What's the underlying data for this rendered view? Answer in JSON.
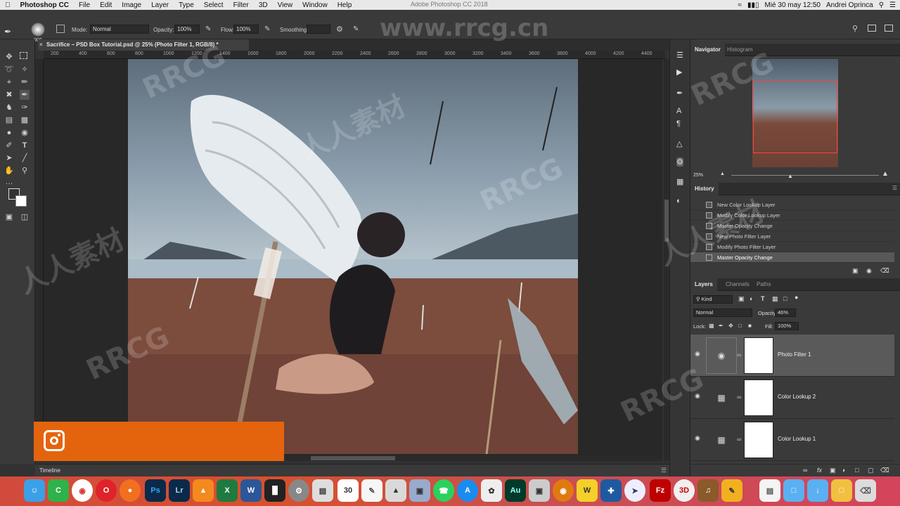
{
  "menubar": {
    "apple": "",
    "items": [
      "Photoshop CC",
      "File",
      "Edit",
      "Image",
      "Layer",
      "Type",
      "Select",
      "Filter",
      "3D",
      "View",
      "Window",
      "Help"
    ],
    "window_title": "Adobe Photoshop CC 2018",
    "clock": "Mié 30 may  12:50",
    "user": "Andrei Oprinca"
  },
  "options": {
    "brush_size": "900",
    "mode_label": "Mode:",
    "mode_value": "Normal",
    "opacity_label": "Opacity:",
    "opacity_value": "100%",
    "flow_label": "Flow:",
    "flow_value": "100%",
    "smoothing_label": "Smoothing:"
  },
  "document": {
    "tab_title": "Sacrifice – PSD Box Tutorial.psd @ 25% (Photo Filter 1, RGB/8) *"
  },
  "ruler_ticks": [
    "200",
    "400",
    "600",
    "800",
    "1000",
    "1200",
    "1400",
    "1600",
    "1800",
    "2000",
    "2200",
    "2400",
    "2600",
    "2800",
    "3000",
    "3200",
    "3400",
    "3600",
    "3800",
    "4000",
    "4200",
    "4400"
  ],
  "timeline": {
    "label": "Timeline"
  },
  "navigator": {
    "tab_active": "Navigator",
    "tab_other": "Histogram",
    "zoom": "25%"
  },
  "history": {
    "title": "History",
    "items": [
      "New Color Lookup Layer",
      "Modify Color Lookup Layer",
      "Master Opacity Change",
      "New Photo Filter Layer",
      "Modify Photo Filter Layer",
      "Master Opacity Change"
    ]
  },
  "layers": {
    "tabs": [
      "Layers",
      "Channels",
      "Paths"
    ],
    "kind_label": "Kind",
    "blend_mode": "Normal",
    "opacity_label": "Opacity:",
    "opacity_value": "46%",
    "lock_label": "Lock:",
    "fill_label": "Fill:",
    "fill_value": "100%",
    "items": [
      {
        "name": "Photo Filter 1",
        "icon": "photo-filter-icon",
        "selected": true
      },
      {
        "name": "Color Lookup 2",
        "icon": "grid-icon",
        "selected": false
      },
      {
        "name": "Color Lookup 1",
        "icon": "grid-icon",
        "selected": false
      }
    ]
  },
  "watermark": {
    "site": "www.rrcg.cn",
    "brand": "RRCG",
    "cn": "人人素材"
  },
  "colors": {
    "banner": "#e4640e",
    "panel_bg": "#3a3a3a",
    "dock_start": "#d14b3d"
  }
}
